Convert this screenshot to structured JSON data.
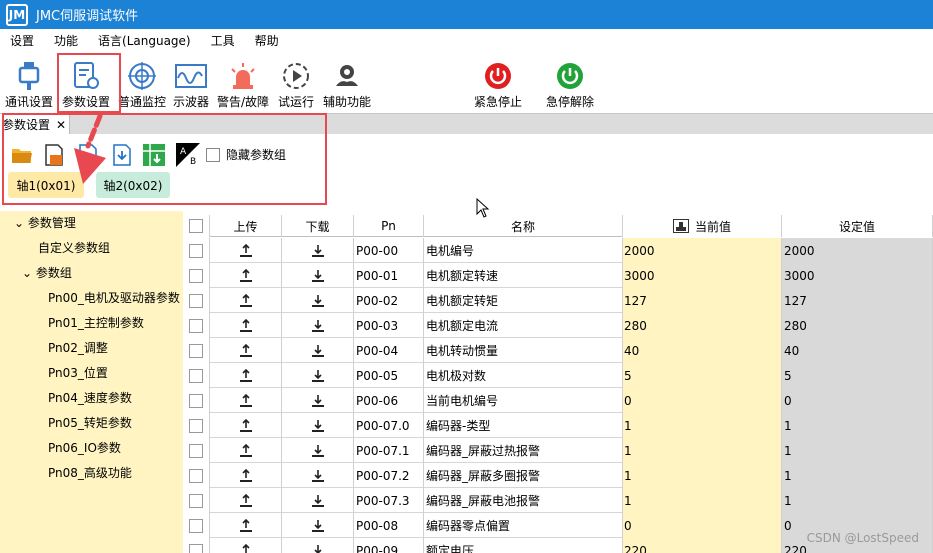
{
  "window": {
    "title": "JMC伺服调试软件",
    "logo_text": "JM"
  },
  "menu": [
    "设置",
    "功能",
    "语言(Language)",
    "工具",
    "帮助"
  ],
  "toolbar": {
    "comm": "通讯设置",
    "params": "参数设置",
    "monitor": "普通监控",
    "scope": "示波器",
    "alarm": "警告/故障",
    "trial": "试运行",
    "aux": "辅助功能",
    "estop": "紧急停止",
    "estop_release": "急停解除"
  },
  "doc_tab": {
    "label": "参数设置",
    "close": "✕"
  },
  "subtoolbar": {
    "hide_group_label": "隐藏参数组",
    "ab_label": "AB"
  },
  "axis_tabs": [
    "轴1(0x01)",
    "轴2(0x02)"
  ],
  "tree": {
    "root": "参数管理",
    "custom": "自定义参数组",
    "groups_label": "参数组",
    "groups": [
      "Pn00_电机及驱动器参数",
      "Pn01_主控制参数",
      "Pn02_调整",
      "Pn03_位置",
      "Pn04_速度参数",
      "Pn05_转矩参数",
      "Pn06_IO参数",
      "Pn08_高级功能"
    ]
  },
  "grid": {
    "headers": {
      "upload": "上传",
      "download": "下载",
      "pn": "Pn",
      "name": "名称",
      "current": "当前值",
      "setting": "设定值"
    },
    "rows": [
      {
        "pn": "P00-00",
        "name": "电机编号",
        "current": "2000",
        "setting": "2000"
      },
      {
        "pn": "P00-01",
        "name": "电机额定转速",
        "current": "3000",
        "setting": "3000"
      },
      {
        "pn": "P00-02",
        "name": "电机额定转矩",
        "current": "127",
        "setting": "127"
      },
      {
        "pn": "P00-03",
        "name": "电机额定电流",
        "current": "280",
        "setting": "280"
      },
      {
        "pn": "P00-04",
        "name": "电机转动惯量",
        "current": "40",
        "setting": "40"
      },
      {
        "pn": "P00-05",
        "name": "电机极对数",
        "current": "5",
        "setting": "5"
      },
      {
        "pn": "P00-06",
        "name": "当前电机编号",
        "current": "0",
        "setting": "0"
      },
      {
        "pn": "P00-07.0",
        "name": "编码器-类型",
        "current": "1",
        "setting": "1"
      },
      {
        "pn": "P00-07.1",
        "name": "编码器_屏蔽过热报警",
        "current": "1",
        "setting": "1"
      },
      {
        "pn": "P00-07.2",
        "name": "编码器_屏蔽多圈报警",
        "current": "1",
        "setting": "1"
      },
      {
        "pn": "P00-07.3",
        "name": "编码器_屏蔽电池报警",
        "current": "1",
        "setting": "1"
      },
      {
        "pn": "P00-08",
        "name": "编码器零点偏置",
        "current": "0",
        "setting": "0"
      },
      {
        "pn": "P00-09",
        "name": "额定电压",
        "current": "220",
        "setting": "220"
      }
    ]
  },
  "watermark": "CSDN @LostSpeed",
  "colors": {
    "title_bar": "#1b82d6",
    "tree_bg": "#fff4c2",
    "current_col": "#fff4c2",
    "setting_col": "#d9d9d9",
    "highlight": "#e8484f",
    "estop_red": "#e02020",
    "release_green": "#22a33a"
  }
}
